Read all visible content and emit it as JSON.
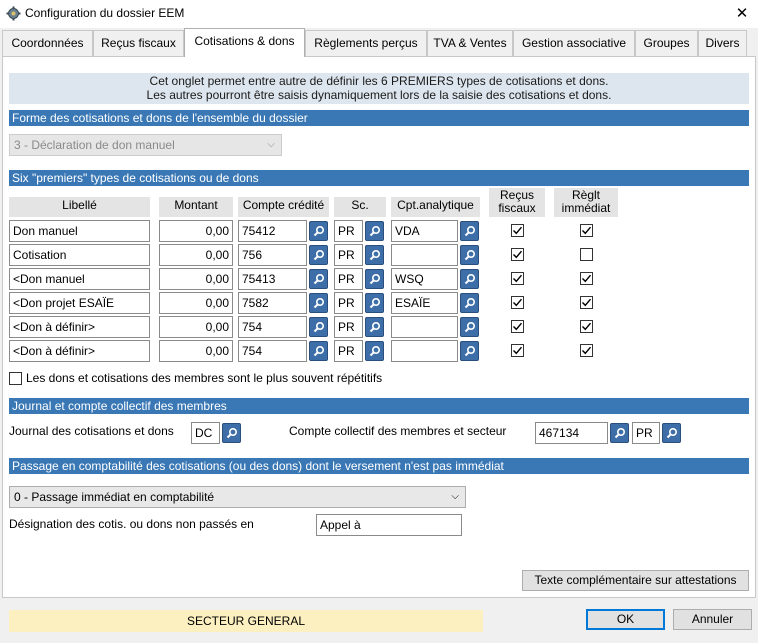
{
  "window": {
    "title": "Configuration du dossier EEM",
    "close_glyph": "✕"
  },
  "tabs": [
    {
      "label": "Coordonnées"
    },
    {
      "label": "Reçus fiscaux"
    },
    {
      "label": "Cotisations & dons"
    },
    {
      "label": "Règlements perçus"
    },
    {
      "label": "TVA & Ventes"
    },
    {
      "label": "Gestion associative"
    },
    {
      "label": "Groupes"
    },
    {
      "label": "Divers"
    }
  ],
  "active_tab": "Cotisations & dons",
  "info": {
    "line1": "Cet onglet permet entre autre de définir les 6 PREMIERS types de cotisations et dons.",
    "line2": "Les autres pourront être saisis dynamiquement lors de la saisie des cotisations et dons."
  },
  "section1": {
    "title": "Forme des cotisations et dons de l'ensemble du dossier"
  },
  "forme_combo": {
    "value": "3 - Déclaration de don manuel",
    "disabled": true
  },
  "section2": {
    "title": "Six \"premiers\" types de cotisations ou de dons"
  },
  "table": {
    "headers": {
      "libelle": "Libellé",
      "montant": "Montant",
      "compte": "Compte crédité",
      "sc": "Sc.",
      "cpt": "Cpt.analytique",
      "recus_1": "Reçus",
      "recus_2": "fiscaux",
      "reglt_1": "Règlt",
      "reglt_2": "immédiat"
    },
    "rows": [
      {
        "libelle": "Don manuel",
        "montant": "0,00",
        "compte": "75412",
        "sc": "PR",
        "cpt": "VDA",
        "recus": true,
        "reglt": true
      },
      {
        "libelle": "Cotisation",
        "montant": "0,00",
        "compte": "756",
        "sc": "PR",
        "cpt": "",
        "recus": true,
        "reglt": false
      },
      {
        "libelle": "<Don manuel",
        "montant": "0,00",
        "compte": "75413",
        "sc": "PR",
        "cpt": "WSQ",
        "recus": true,
        "reglt": true
      },
      {
        "libelle": "<Don projet ESAÏE",
        "montant": "0,00",
        "compte": "7582",
        "sc": "PR",
        "cpt": "ESAÏE",
        "recus": true,
        "reglt": true
      },
      {
        "libelle": "<Don à définir>",
        "montant": "0,00",
        "compte": "754",
        "sc": "PR",
        "cpt": "",
        "recus": true,
        "reglt": true
      },
      {
        "libelle": "<Don à définir>",
        "montant": "0,00",
        "compte": "754",
        "sc": "PR",
        "cpt": "",
        "recus": true,
        "reglt": true
      }
    ]
  },
  "repetitifs": {
    "label": "Les dons et cotisations des membres sont le plus souvent répétitifs",
    "checked": false
  },
  "section3": {
    "title": "Journal et compte collectif des membres"
  },
  "journal": {
    "label": "Journal des cotisations et dons",
    "value": "DC"
  },
  "collectif": {
    "label": "Compte collectif des membres et secteur",
    "compte": "467134",
    "secteur": "PR"
  },
  "section4": {
    "title": "Passage en comptabilité des cotisations (ou des dons) dont le versement n'est pas immédiat"
  },
  "passage_combo": {
    "value": "0 - Passage immédiat en comptabilité"
  },
  "designation": {
    "label": "Désignation des cotis. ou dons non passés en",
    "value": "Appel à"
  },
  "buttons": {
    "texte_complementaire": "Texte complémentaire sur attestations",
    "ok": "OK",
    "annuler": "Annuler"
  },
  "status": {
    "secteur": "SECTEUR GENERAL"
  },
  "icons": {
    "search": "search-icon",
    "check": "check-icon",
    "dropdown": "chevron-down-icon",
    "app": "gear-icon"
  },
  "colors": {
    "section_bar": "#3a78b5",
    "info_bg": "#dde6ee",
    "search_button": "#3d6ea8",
    "status_bg": "#fdf0c0"
  }
}
